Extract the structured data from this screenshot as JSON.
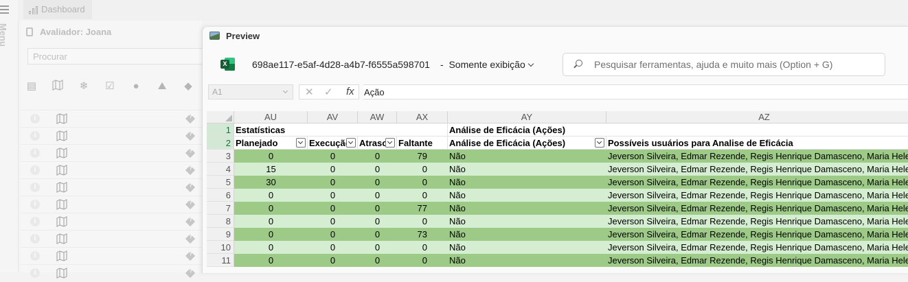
{
  "app": {
    "menu_label": "Menu",
    "dashboard_tab": "Dashboard",
    "evaluator": "Avaliador: Joana",
    "search_placeholder": "Procurar"
  },
  "preview": {
    "title": "Preview",
    "file_name": "698ae117-e5af-4d28-a4b7-f6555a598701",
    "separator": "-",
    "mode": "Somente exibição",
    "search_placeholder": "Pesquisar ferramentas, ajuda e muito mais (Option + G)",
    "name_box": "A1",
    "fx": "fx",
    "formula_value": "Ação"
  },
  "sheet": {
    "columns": [
      "AU",
      "AV",
      "AW",
      "AX",
      "AY",
      "AZ"
    ],
    "row1": {
      "num": "1",
      "AU": "Estatísticas",
      "AY": "Análise de Eficácia (Ações)"
    },
    "row2": {
      "num": "2",
      "AU": "Planejado",
      "AV": "Execução",
      "AW": "Atraso",
      "AX": "Faltante",
      "AY": "Análise de Eficácia (Ações)",
      "AZ": "Possíveis usuários para Analise de Eficácia"
    },
    "rows": [
      {
        "num": "3",
        "planejado": "0",
        "execucao": "0",
        "atraso": "0",
        "faltante": "79",
        "analise": "Não",
        "usuarios": "Jeverson Silveira, Edmar Rezende, Regis Henrique Damasceno, Maria Hele"
      },
      {
        "num": "4",
        "planejado": "15",
        "execucao": "0",
        "atraso": "0",
        "faltante": "0",
        "analise": "Não",
        "usuarios": "Jeverson Silveira, Edmar Rezende, Regis Henrique Damasceno, Maria Hele"
      },
      {
        "num": "5",
        "planejado": "30",
        "execucao": "0",
        "atraso": "0",
        "faltante": "0",
        "analise": "Não",
        "usuarios": "Jeverson Silveira, Edmar Rezende, Regis Henrique Damasceno, Maria Hele"
      },
      {
        "num": "6",
        "planejado": "0",
        "execucao": "0",
        "atraso": "0",
        "faltante": "0",
        "analise": "Não",
        "usuarios": "Jeverson Silveira, Edmar Rezende, Regis Henrique Damasceno, Maria Hele"
      },
      {
        "num": "7",
        "planejado": "0",
        "execucao": "0",
        "atraso": "0",
        "faltante": "77",
        "analise": "Não",
        "usuarios": "Jeverson Silveira, Edmar Rezende, Regis Henrique Damasceno, Maria Hele"
      },
      {
        "num": "8",
        "planejado": "0",
        "execucao": "0",
        "atraso": "0",
        "faltante": "0",
        "analise": "Não",
        "usuarios": "Jeverson Silveira, Edmar Rezende, Regis Henrique Damasceno, Maria Hele"
      },
      {
        "num": "9",
        "planejado": "0",
        "execucao": "0",
        "atraso": "0",
        "faltante": "73",
        "analise": "Não",
        "usuarios": "Jeverson Silveira, Edmar Rezende, Regis Henrique Damasceno, Maria Hele"
      },
      {
        "num": "10",
        "planejado": "0",
        "execucao": "0",
        "atraso": "0",
        "faltante": "0",
        "analise": "Não",
        "usuarios": "Jeverson Silveira, Edmar Rezende, Regis Henrique Damasceno, Maria Hele"
      },
      {
        "num": "11",
        "planejado": "0",
        "execucao": "0",
        "atraso": "0",
        "faltante": "0",
        "analise": "Não",
        "usuarios": "Jeverson Silveira, Edmar Rezende, Regis Henrique Damasceno, Maria Hele"
      }
    ]
  },
  "icons": {
    "toolbar": [
      "clipboard-icon",
      "map-icon",
      "person-icon",
      "checklist-icon",
      "whatsapp-icon",
      "helmet-icon",
      "help-diamond-icon"
    ],
    "row_info": "info-icon",
    "row_map": "map-icon",
    "row_help": "help-diamond-icon"
  },
  "colors": {
    "band_dark": "#9dcb87",
    "band_light": "#d5edd0",
    "excel_green": "#107c41"
  }
}
